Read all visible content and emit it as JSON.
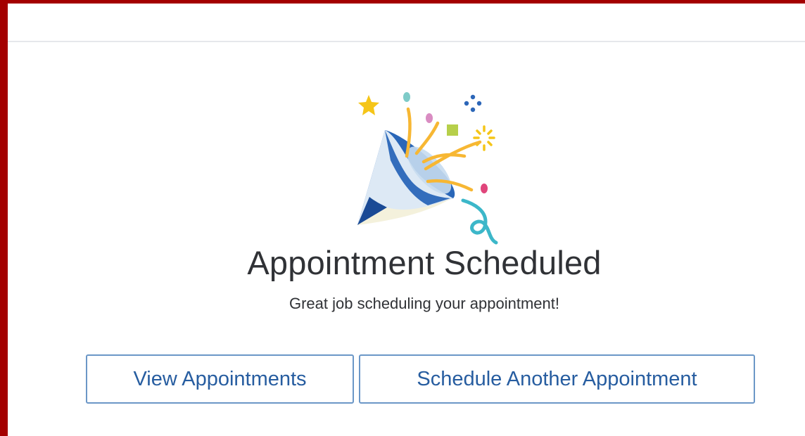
{
  "confirmation": {
    "title": "Appointment Scheduled",
    "subtitle": "Great job scheduling your appointment!",
    "illustration_icon": "party-popper-icon"
  },
  "actions": {
    "view_appointments_label": "View Appointments",
    "schedule_another_label": "Schedule Another Appointment"
  },
  "colors": {
    "frame_border": "#a40000",
    "button_border": "#6b97c7",
    "button_text": "#275da0",
    "text_dark": "#303236"
  }
}
